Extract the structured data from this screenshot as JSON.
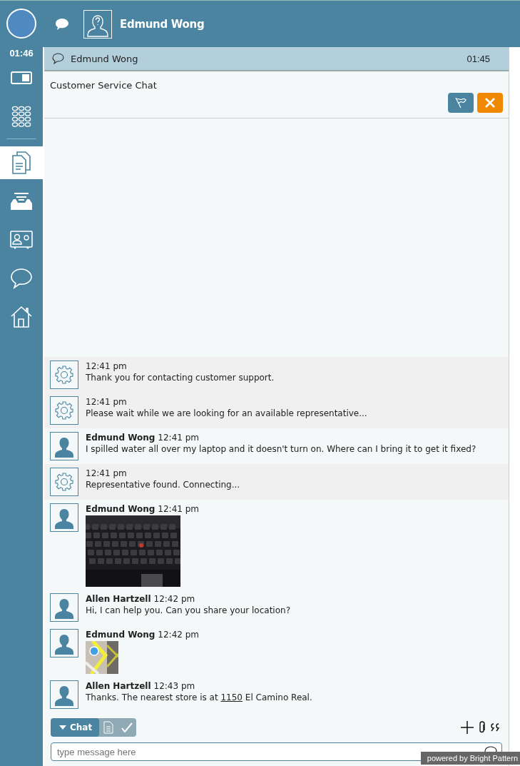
{
  "sidebar": {
    "timer": "01:46",
    "items": [
      {
        "kind": "toggle",
        "selected": false
      },
      {
        "kind": "dialpad",
        "selected": false
      },
      {
        "kind": "documents",
        "selected": true
      },
      {
        "kind": "inbox",
        "selected": false
      },
      {
        "kind": "contact",
        "selected": false
      },
      {
        "kind": "chat",
        "selected": false
      },
      {
        "kind": "home",
        "selected": false
      }
    ]
  },
  "header": {
    "contact_name": "Edmund Wong"
  },
  "interaction": {
    "title": "Edmund Wong",
    "time": "01:45",
    "subject": "Customer Service Chat"
  },
  "messages": [
    {
      "kind": "system",
      "time": "12:41 pm",
      "parts": [
        {
          "kind": "plain",
          "text": "Thank you for contacting customer support."
        }
      ]
    },
    {
      "kind": "system",
      "time": "12:41 pm",
      "parts": [
        {
          "kind": "plain",
          "text": "Please wait while we are looking for an available representative..."
        }
      ]
    },
    {
      "kind": "user",
      "author": "Edmund Wong",
      "time": "12:41 pm",
      "parts": [
        {
          "kind": "plain",
          "text": "I spilled water all over my laptop and it doesn't turn on. Where can I bring it to get it fixed?"
        }
      ]
    },
    {
      "kind": "system",
      "time": "12:41 pm",
      "parts": [
        {
          "kind": "plain",
          "text": "Representative found. Connecting..."
        }
      ]
    },
    {
      "kind": "picture",
      "author": "Edmund Wong",
      "time": "12:41 pm"
    },
    {
      "kind": "user",
      "author": "Allen Hartzell",
      "time": "12:42 pm",
      "parts": [
        {
          "kind": "plain",
          "text": "Hi, I can help you. Can you share your location?"
        }
      ]
    },
    {
      "kind": "picture",
      "author": "Edmund Wong",
      "time": "12:42 pm"
    },
    {
      "kind": "user",
      "author": "Allen Hartzell",
      "time": "12:43 pm",
      "parts": [
        {
          "kind": "plain",
          "text": "Thanks. The nearest store is at "
        },
        {
          "kind": "link",
          "text": "1150"
        },
        {
          "kind": "plain",
          "text": " El Camino Real."
        }
      ]
    }
  ],
  "composer": {
    "mode": "Chat",
    "placeholder": "type message here"
  },
  "footer_badge": "powered by Bright Pattern"
}
